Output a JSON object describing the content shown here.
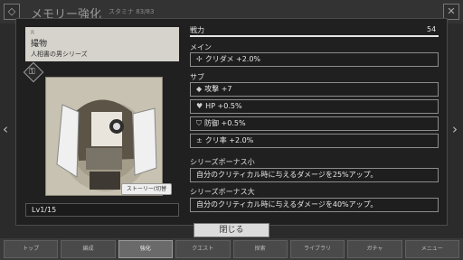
{
  "background": {
    "title": "メモリー強化",
    "stamina": "スタミナ 83/83"
  },
  "card": {
    "rarity": "R",
    "name": "撮物",
    "series": "人相書の男シリーズ",
    "story_label": "ストーリー",
    "story_status": "ストーリー(切替",
    "level": "Lv1/15"
  },
  "stats": {
    "power_label": "戦力",
    "power_value": "54",
    "power_fill": 1.0,
    "main_label": "メイン",
    "main": [
      {
        "icon": "sparkle-icon",
        "text": "クリダメ +2.0%"
      }
    ],
    "sub_label": "サブ",
    "sub": [
      {
        "icon": "attack-icon",
        "text": "攻撃 +7"
      },
      {
        "icon": "heart-icon",
        "text": "HP +0.5%"
      },
      {
        "icon": "shield-icon",
        "text": "防御 +0.5%"
      },
      {
        "icon": "crit-icon",
        "text": "クリ率 +2.0%"
      }
    ],
    "series_small_label": "シリーズボーナス小",
    "series_small_text": "自分のクリティカル時に与えるダメージを25%アップ。",
    "series_large_label": "シリーズボーナス大",
    "series_large_text": "自分のクリティカル時に与えるダメージを40%アップ。"
  },
  "buttons": {
    "close": "閉じる"
  },
  "nav": [
    {
      "label": "トップ",
      "active": false
    },
    {
      "label": "編成",
      "active": false
    },
    {
      "label": "強化",
      "active": true
    },
    {
      "label": "クエスト",
      "active": false
    },
    {
      "label": "探索",
      "active": false
    },
    {
      "label": "ライブラリ",
      "active": false
    },
    {
      "label": "ガチャ",
      "active": false
    },
    {
      "label": "メニュー",
      "active": false
    }
  ]
}
